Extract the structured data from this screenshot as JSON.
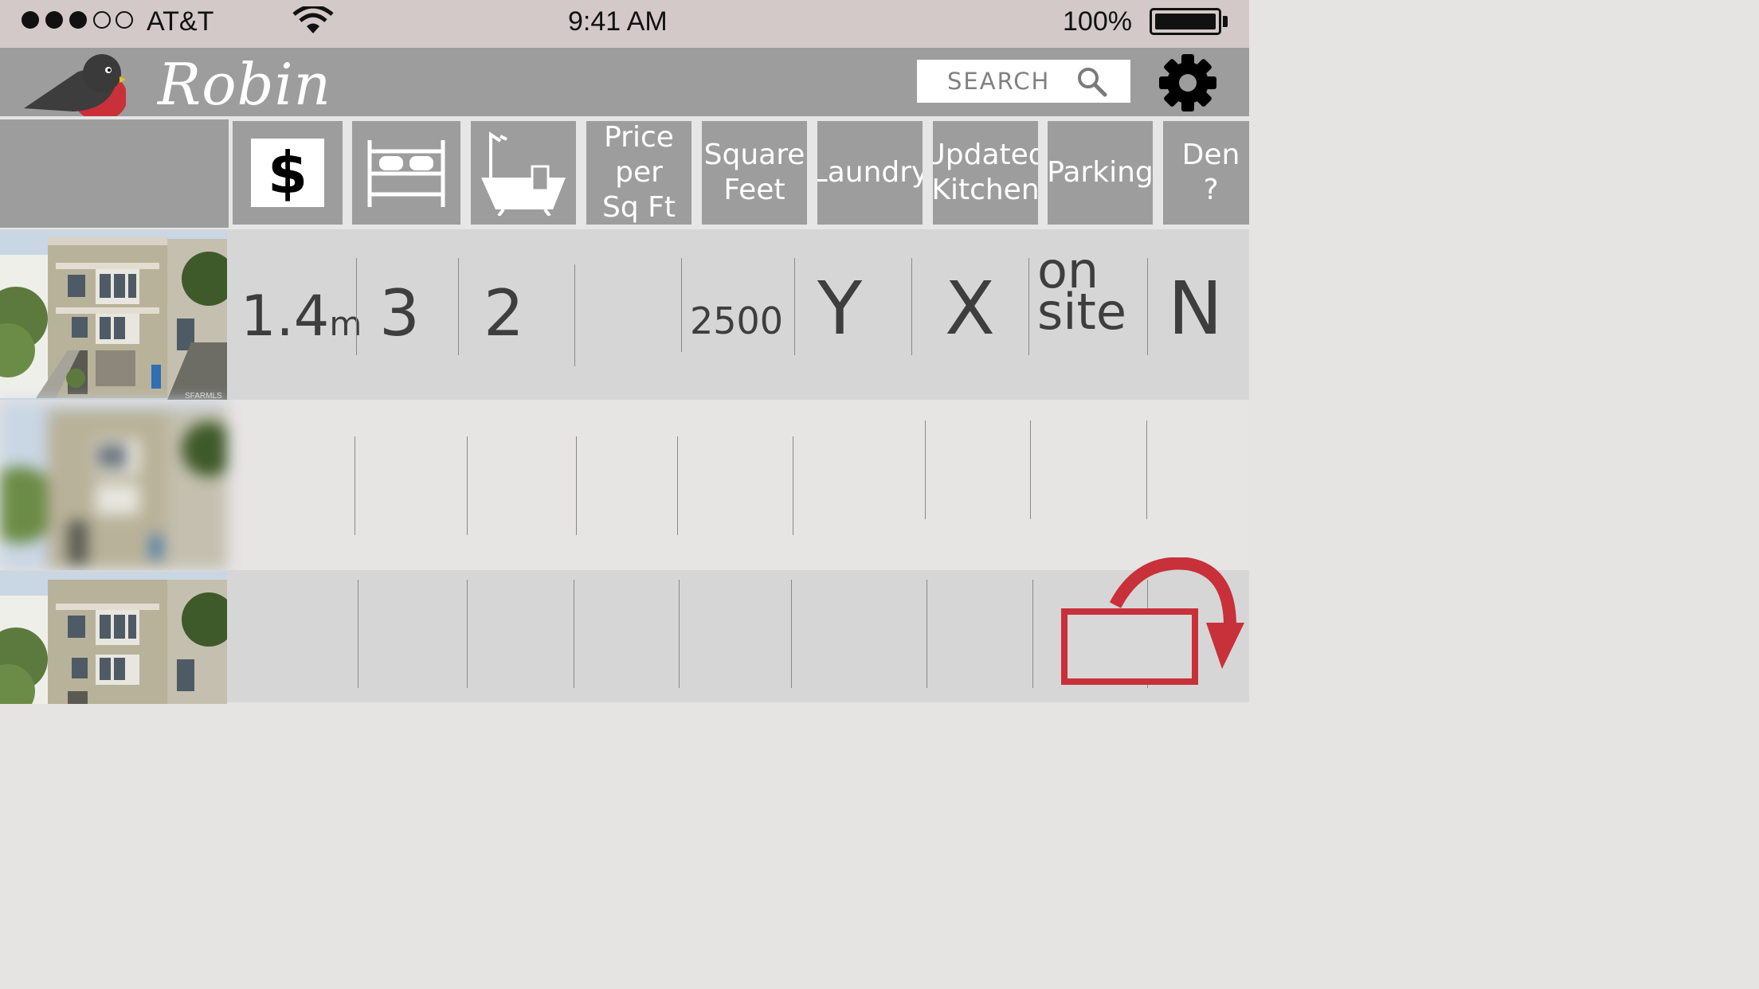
{
  "status_bar": {
    "carrier": "AT&T",
    "time": "9:41 AM",
    "battery": "100%",
    "signal_bars_filled": 3,
    "signal_bars_total": 5
  },
  "app": {
    "title": "Robin",
    "accent_color": "#c8303a",
    "search": {
      "placeholder": "SEARCH"
    }
  },
  "columns": [
    {
      "key": "price",
      "icon": "dollar-icon"
    },
    {
      "key": "bedrooms",
      "icon": "bed-icon"
    },
    {
      "key": "bathrooms",
      "icon": "bathtub-icon"
    },
    {
      "key": "price_per_sqft",
      "label": "Price per\nSq Ft"
    },
    {
      "key": "square_feet",
      "label": "Square\nFeet"
    },
    {
      "key": "laundry",
      "label": "Laundry"
    },
    {
      "key": "updated_kitchen",
      "label": "Updated\nKitchen"
    },
    {
      "key": "parking",
      "label": "Parking"
    },
    {
      "key": "den",
      "label": "Den ?"
    }
  ],
  "listings": [
    {
      "price": "1.4",
      "price_unit": "m",
      "bedrooms": "3",
      "bathrooms": "2",
      "price_per_sqft": "",
      "square_feet": "2500",
      "laundry": "Y",
      "updated_kitchen": "X",
      "parking": "on\nsite",
      "den": "N",
      "photo_watermark": "SFARMLS"
    },
    {
      "blurred": true
    },
    {
      "partially_visible": true
    }
  ],
  "rotate_hint_icon": "rotate-device-icon"
}
